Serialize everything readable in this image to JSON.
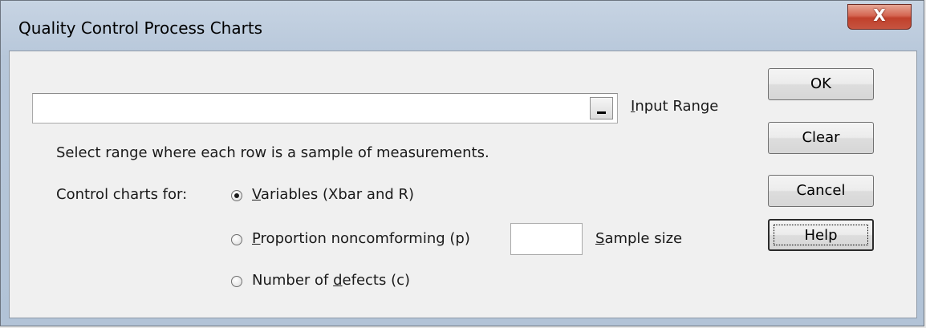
{
  "window": {
    "title": "Quality Control Process Charts",
    "close_icon_glyph": "X"
  },
  "input_range": {
    "value": "",
    "button_glyph": "_",
    "label_mnemonic": "I",
    "label_rest": "nput Range"
  },
  "instruction_text": "Select range where each row is a sample of measurements.",
  "control_charts_label": "Control charts for:",
  "options": {
    "variables": {
      "mnemonic": "V",
      "rest": "ariables (Xbar and R)",
      "checked": true
    },
    "proportion": {
      "mnemonic": "P",
      "rest": "roportion noncomforming (p)",
      "checked": false
    },
    "defects": {
      "pre": "Number of ",
      "mnemonic": "d",
      "rest": "efects (c)",
      "checked": false
    }
  },
  "sample_size": {
    "value": "",
    "label_mnemonic": "S",
    "label_rest": "ample size"
  },
  "buttons": {
    "ok": "OK",
    "clear": "Clear",
    "cancel": "Cancel",
    "help": "Help"
  }
}
